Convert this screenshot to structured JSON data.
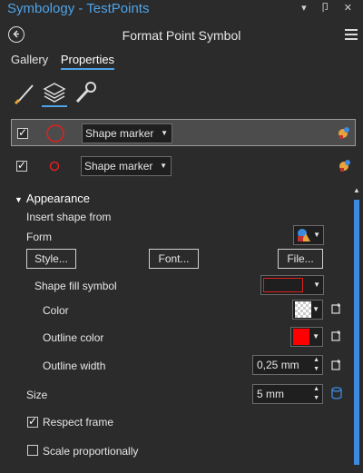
{
  "window": {
    "title": "Symbology - TestPoints",
    "controls": "▾ 卩 ✕"
  },
  "header": {
    "title": "Format Point Symbol"
  },
  "tabs": [
    {
      "label": "Gallery"
    },
    {
      "label": "Properties"
    }
  ],
  "layers": [
    {
      "checked": true,
      "marker_type": "Shape marker"
    },
    {
      "checked": true,
      "marker_type": "Shape marker"
    }
  ],
  "appearance": {
    "section_label": "Appearance",
    "insert_shape_from": "Insert shape from",
    "form_label": "Form",
    "style_button": "Style...",
    "font_button": "Font...",
    "file_button": "File...",
    "shape_fill_symbol_label": "Shape fill symbol",
    "color_label": "Color",
    "outline_color_label": "Outline color",
    "outline_width_label": "Outline width",
    "outline_width_value": "0,25 mm",
    "size_label": "Size",
    "size_value": "5 mm",
    "respect_frame_label": "Respect frame",
    "respect_frame_checked": true,
    "scale_proportionally_label": "Scale proportionally",
    "scale_proportionally_checked": false
  },
  "colors": {
    "accent": "#4fa3e8",
    "outline_red": "#ff0000",
    "fill_preview_border": "#e02020"
  },
  "icons": [
    "back-arrow-icon",
    "hamburger-menu-icon",
    "paintbrush-icon",
    "layers-icon",
    "wrench-icon",
    "marker-color-icon",
    "add-layer-icon",
    "database-icon"
  ]
}
